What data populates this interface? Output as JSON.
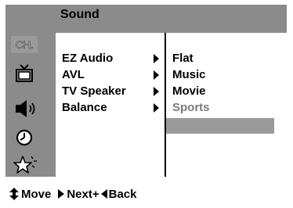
{
  "menu": {
    "title": "Sound",
    "icons": [
      {
        "name": "channel-icon",
        "text": "CH."
      },
      {
        "name": "tv-icon"
      },
      {
        "name": "speaker-icon"
      },
      {
        "name": "clock-icon"
      },
      {
        "name": "star-icon"
      }
    ],
    "items": [
      {
        "label": "EZ Audio"
      },
      {
        "label": "AVL"
      },
      {
        "label": "TV Speaker"
      },
      {
        "label": "Balance"
      }
    ],
    "options": [
      {
        "label": "Flat",
        "state": "normal"
      },
      {
        "label": "Music",
        "state": "normal"
      },
      {
        "label": "Movie",
        "state": "normal"
      },
      {
        "label": "Sports",
        "state": "dimmed"
      }
    ]
  },
  "footer": {
    "move_label": "Move",
    "next_label": "Next+",
    "back_label": "Back"
  },
  "colors": {
    "frame": "#8b8b8b",
    "highlight": "#9a9a9a",
    "dimmed_text": "#7a7a7a",
    "text": "#000000"
  }
}
